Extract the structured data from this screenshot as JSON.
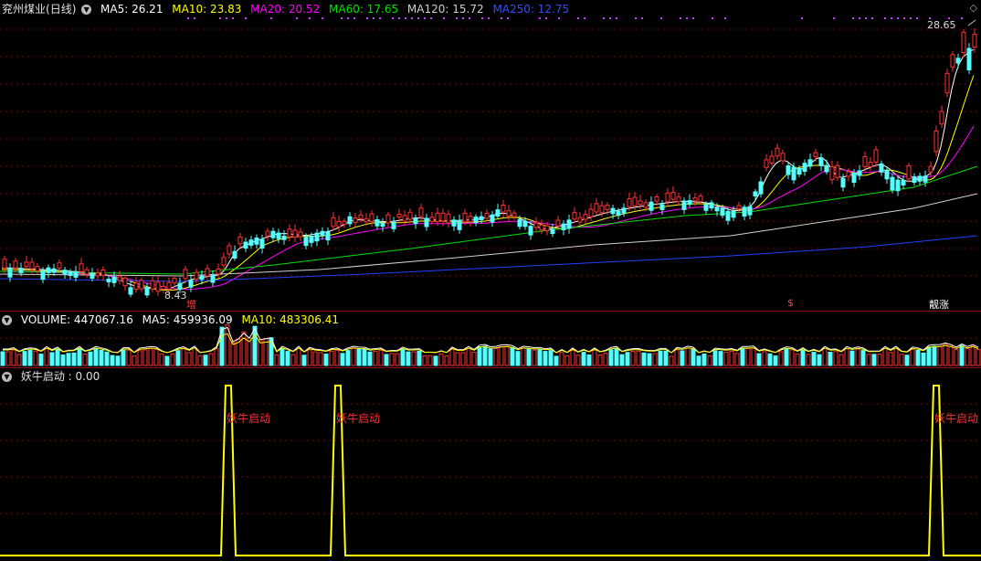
{
  "stock": {
    "name": "兖州煤业",
    "period": "(日线)"
  },
  "ma": [
    {
      "label": "MA5: 26.21",
      "color": "#ffffff"
    },
    {
      "label": "MA10: 23.83",
      "color": "#ffff00"
    },
    {
      "label": "MA20: 20.52",
      "color": "#ff00ff"
    },
    {
      "label": "MA60: 17.65",
      "color": "#00e000"
    },
    {
      "label": "MA120: 15.72",
      "color": "#d0d0d0"
    },
    {
      "label": "MA250: 12.75",
      "color": "#3050ff"
    }
  ],
  "price": {
    "high_label": "28.65",
    "low_label": "8.43"
  },
  "markers": {
    "zeng": "增",
    "s": "$",
    "jz": "靓涨"
  },
  "volume": [
    {
      "label": "VOLUME: 447067.16",
      "color": "#ffffff"
    },
    {
      "label": "MA5: 459936.09",
      "color": "#ffffff"
    },
    {
      "label": "MA10: 483306.41",
      "color": "#ffff00"
    }
  ],
  "indicator": {
    "title": "妖牛启动 : 0.00",
    "signal_label": "妖牛启动",
    "signals": [
      250,
      370,
      1025
    ]
  },
  "colors": {
    "up": "#ff3232",
    "down": "#54ffff",
    "grid": "#7a0000"
  }
}
